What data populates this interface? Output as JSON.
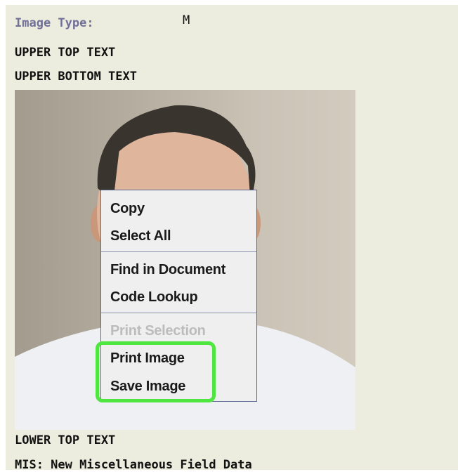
{
  "header": {
    "image_type_label": "Image Type:",
    "image_type_value": "M",
    "upper_top_text": "UPPER TOP TEXT",
    "upper_bottom_text": "UPPER BOTTOM TEXT"
  },
  "footer": {
    "lower_top_text": "LOWER TOP TEXT",
    "mis_text": "MIS: New Miscellaneous Field Data"
  },
  "context_menu": {
    "items": [
      {
        "label": "Copy",
        "enabled": true
      },
      {
        "label": "Select All",
        "enabled": true
      },
      {
        "label": "Find in Document",
        "enabled": true
      },
      {
        "label": "Code Lookup",
        "enabled": true
      },
      {
        "label": "Print Selection",
        "enabled": false
      },
      {
        "label": "Print Image",
        "enabled": true
      },
      {
        "label": "Save Image",
        "enabled": true
      }
    ],
    "highlighted_items": [
      "Print Image",
      "Save Image"
    ]
  },
  "colors": {
    "panel_background": "#eceddf",
    "label_color": "#6f6f98",
    "menu_border": "#5c6a96",
    "highlight": "#4fe63f",
    "disabled_text": "#bcbcbc"
  }
}
